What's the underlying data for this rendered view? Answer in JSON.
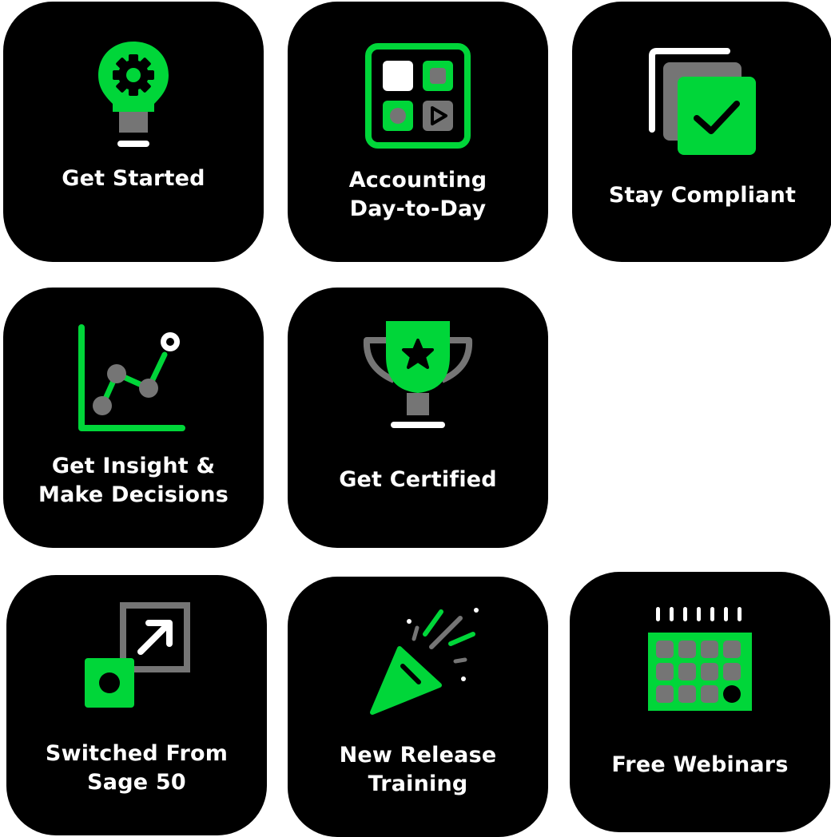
{
  "colors": {
    "tile_bg": "#000000",
    "accent": "#00d639",
    "gray": "#757575",
    "white": "#ffffff"
  },
  "tiles": [
    {
      "id": "get-started",
      "icon": "lightbulb-gear-icon",
      "lines": [
        "Get Started"
      ]
    },
    {
      "id": "accounting-day-to-day",
      "icon": "app-grid-icon",
      "lines": [
        "Accounting",
        "Day-to-Day"
      ]
    },
    {
      "id": "stay-compliant",
      "icon": "checked-documents-icon",
      "lines": [
        "Stay Compliant"
      ]
    },
    {
      "id": "get-insight",
      "icon": "line-graph-icon",
      "lines": [
        "Get Insight &",
        "Make Decisions"
      ]
    },
    {
      "id": "get-certified",
      "icon": "trophy-icon",
      "lines": [
        "Get Certified"
      ]
    },
    {
      "id": "switched-from-sage-50",
      "icon": "switch-arrow-icon",
      "lines": [
        "Switched From",
        "Sage 50"
      ]
    },
    {
      "id": "new-release-training",
      "icon": "party-popper-icon",
      "lines": [
        "New Release",
        "Training"
      ]
    },
    {
      "id": "free-webinars",
      "icon": "calendar-icon",
      "lines": [
        "Free Webinars"
      ]
    }
  ]
}
